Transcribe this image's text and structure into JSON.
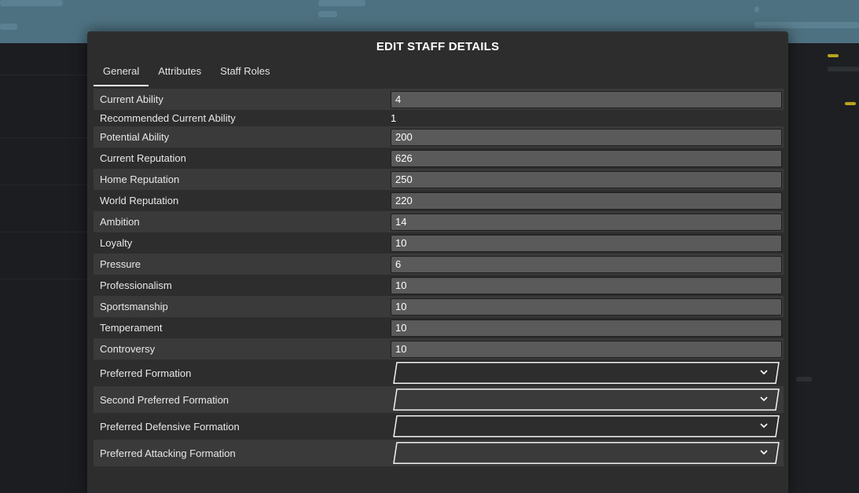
{
  "dialog": {
    "title": "EDIT STAFF DETAILS",
    "tabs": [
      {
        "label": "General",
        "active": true
      },
      {
        "label": "Attributes",
        "active": false
      },
      {
        "label": "Staff Roles",
        "active": false
      }
    ]
  },
  "fields": {
    "current_ability": {
      "label": "Current Ability",
      "value": "4"
    },
    "recommended_current_ability": {
      "label": "Recommended Current Ability",
      "value": "1"
    },
    "potential_ability": {
      "label": "Potential Ability",
      "value": "200"
    },
    "current_reputation": {
      "label": "Current Reputation",
      "value": "626"
    },
    "home_reputation": {
      "label": "Home Reputation",
      "value": "250"
    },
    "world_reputation": {
      "label": "World Reputation",
      "value": "220"
    },
    "ambition": {
      "label": "Ambition",
      "value": "14"
    },
    "loyalty": {
      "label": "Loyalty",
      "value": "10"
    },
    "pressure": {
      "label": "Pressure",
      "value": "6"
    },
    "professionalism": {
      "label": "Professionalism",
      "value": "10"
    },
    "sportsmanship": {
      "label": "Sportsmanship",
      "value": "10"
    },
    "temperament": {
      "label": "Temperament",
      "value": "10"
    },
    "controversy": {
      "label": "Controversy",
      "value": "10"
    },
    "preferred_formation": {
      "label": "Preferred Formation",
      "value": ""
    },
    "second_preferred_formation": {
      "label": "Second Preferred Formation",
      "value": ""
    },
    "preferred_defensive_formation": {
      "label": "Preferred Defensive Formation",
      "value": ""
    },
    "preferred_attacking_formation": {
      "label": "Preferred Attacking Formation",
      "value": ""
    }
  },
  "icons": {
    "dropdown": "chevron-down-icon"
  },
  "colors": {
    "panel": "#2d2d2e",
    "row_shade": "#3a3a3b",
    "input": "#5a5a5b",
    "header_bg": "#4e7181"
  }
}
